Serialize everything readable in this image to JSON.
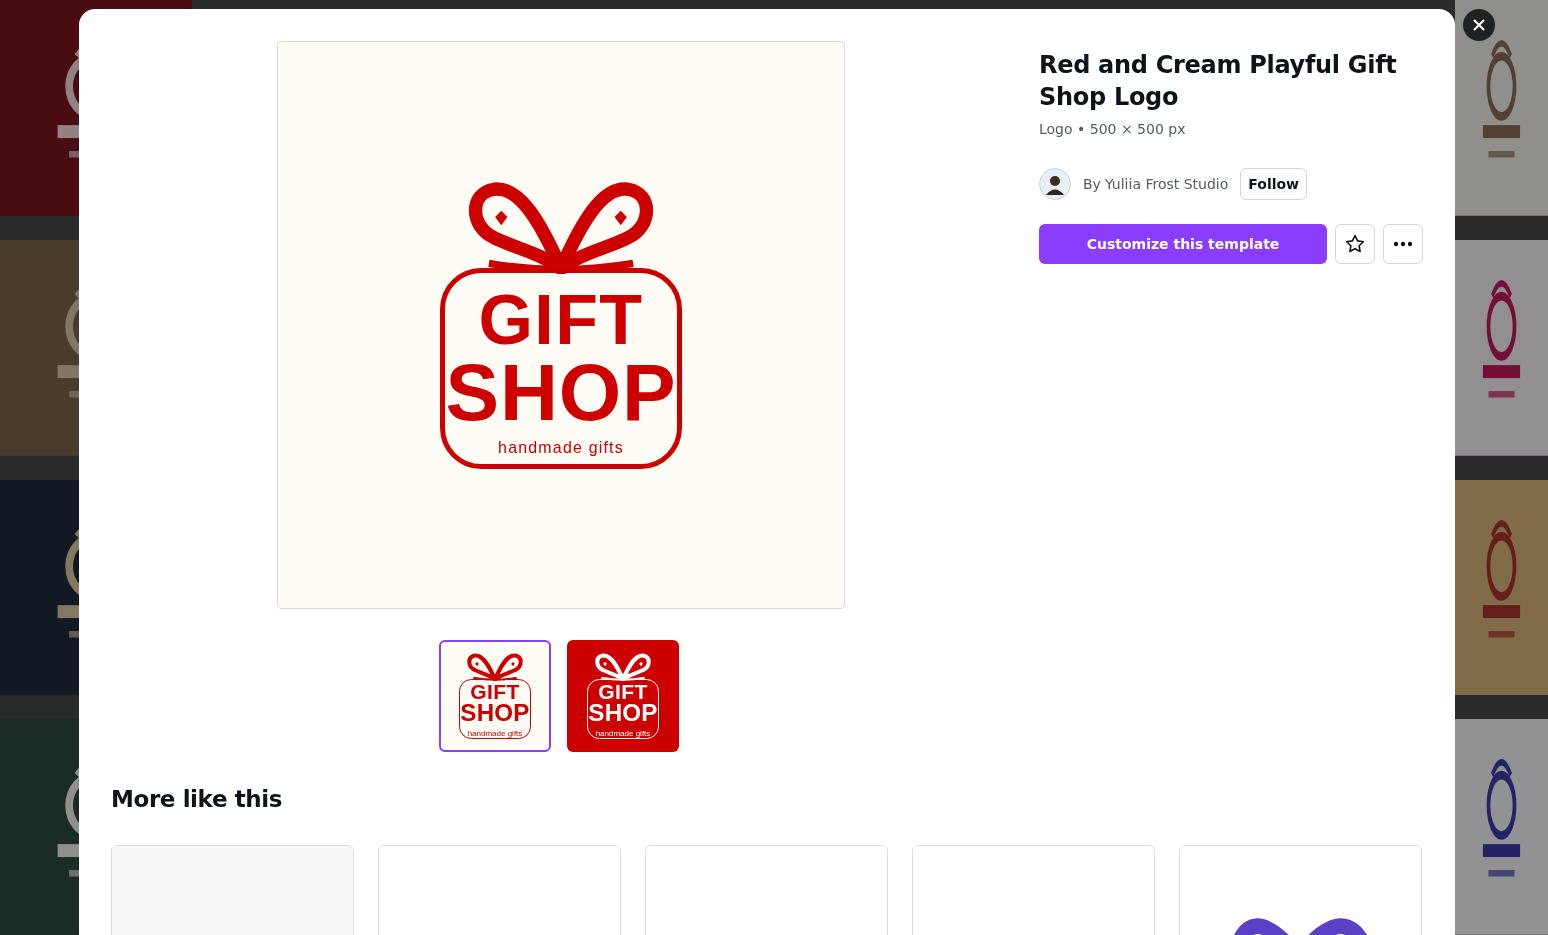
{
  "preview": {
    "kind": "cream",
    "line1": "GIFT",
    "line2": "SHOP",
    "tagline": "handmade gifts"
  },
  "thumbnails": [
    {
      "kind": "cream",
      "selected": true,
      "line1": "GIFT",
      "line2": "SHOP",
      "tagline": "handmade gifts"
    },
    {
      "kind": "red",
      "selected": false,
      "line1": "GIFT",
      "line2": "SHOP",
      "tagline": "handmade gifts"
    }
  ],
  "title": "Red and Cream Playful Gift Shop Logo",
  "meta": "Logo • 500 × 500 px",
  "author": {
    "prefix": "By",
    "name": "Yuliia Frost Studio",
    "follow": "Follow"
  },
  "customize_button": "Customize this template",
  "favorite": {
    "starred": false
  },
  "section_title": "More like this"
}
